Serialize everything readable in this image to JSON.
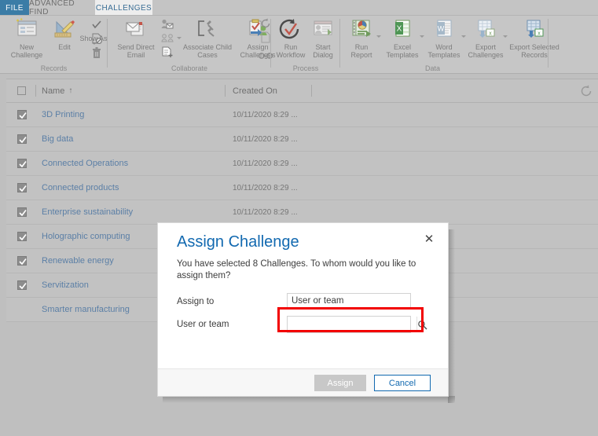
{
  "window": {
    "faint_top_text": "•• ••• ••   •• •• ••"
  },
  "tabs": [
    {
      "label": "FILE",
      "state": "file"
    },
    {
      "label": "ADVANCED FIND",
      "state": "inactive"
    },
    {
      "label": "CHALLENGES",
      "state": "active"
    }
  ],
  "ribbon": {
    "groups": [
      {
        "name": "Records",
        "label": "Records",
        "buttons": [
          {
            "label": "New Challenge",
            "icon": "new-record-icon"
          },
          {
            "label": "Edit",
            "icon": "edit-pencil-ruler-icon"
          },
          {
            "label": "Show As",
            "icon": "show-as-icon",
            "caret": true
          }
        ],
        "mini_icons": [
          {
            "icon": "check-icon"
          },
          {
            "icon": "deactivate-document-icon"
          },
          {
            "icon": "delete-trash-icon"
          }
        ]
      },
      {
        "name": "Collaborate",
        "label": "Collaborate",
        "buttons": [
          {
            "label": "Send Direct Email",
            "icon": "send-direct-email-icon"
          },
          {
            "label": "Associate Child Cases",
            "icon": "associate-child-cases-icon"
          },
          {
            "label": "Assign Challenges",
            "icon": "assign-challenges-icon"
          }
        ],
        "mini_icons": [
          {
            "icon": "add-contact-icon"
          },
          {
            "icon": "connections-icon",
            "caret": true
          },
          {
            "icon": "add-note-icon"
          },
          {
            "icon": "sync-icon"
          },
          {
            "icon": "document-icon"
          },
          {
            "icon": "link-icon"
          }
        ]
      },
      {
        "name": "Process",
        "label": "Process",
        "buttons": [
          {
            "label": "Run Workflow",
            "icon": "run-workflow-icon"
          },
          {
            "label": "Start Dialog",
            "icon": "start-dialog-icon"
          }
        ],
        "mini_icons": []
      },
      {
        "name": "Data",
        "label": "Data",
        "buttons": [
          {
            "label": "Run Report",
            "icon": "run-report-icon",
            "caret": true
          },
          {
            "label": "Excel Templates",
            "icon": "excel-template-icon",
            "caret": true
          },
          {
            "label": "Word Templates",
            "icon": "word-template-icon",
            "caret": true
          },
          {
            "label": "Export Challenges",
            "icon": "export-challenges-icon",
            "caret": true
          },
          {
            "label": "Export Selected Records",
            "icon": "export-selected-records-icon"
          }
        ],
        "mini_icons": []
      }
    ]
  },
  "grid": {
    "refresh_icon": "refresh-icon",
    "columns": [
      {
        "label": "",
        "key": "select"
      },
      {
        "label": "Name",
        "key": "name",
        "sort": "↑"
      },
      {
        "label": "Created On",
        "key": "created_on"
      }
    ],
    "rows": [
      {
        "name": "3D Printing",
        "created_on": "10/11/2020 8:29 ...",
        "selected": true
      },
      {
        "name": "Big data",
        "created_on": "10/11/2020 8:29 ...",
        "selected": true
      },
      {
        "name": "Connected Operations",
        "created_on": "10/11/2020 8:29 ...",
        "selected": true
      },
      {
        "name": "Connected products",
        "created_on": "10/11/2020 8:29 ...",
        "selected": true
      },
      {
        "name": "Enterprise sustainability",
        "created_on": "10/11/2020 8:29 ...",
        "selected": true
      },
      {
        "name": "Holographic computing",
        "created_on": "",
        "selected": true
      },
      {
        "name": "Renewable energy",
        "created_on": "",
        "selected": true
      },
      {
        "name": "Servitization",
        "created_on": "",
        "selected": true
      },
      {
        "name": "Smarter manufacturing",
        "created_on": "",
        "selected": false
      }
    ]
  },
  "dialog": {
    "title": "Assign Challenge",
    "close_label": "✕",
    "description": "You have selected 8 Challenges. To whom would you like to assign them?",
    "fields": [
      {
        "label": "Assign to",
        "value": "User or team",
        "placeholder": ""
      },
      {
        "label": "User or team",
        "value": "",
        "placeholder": ""
      }
    ],
    "lookup_icon": "search-icon",
    "buttons": {
      "assign": "Assign",
      "cancel": "Cancel"
    },
    "highlight_color": "#f20000"
  }
}
